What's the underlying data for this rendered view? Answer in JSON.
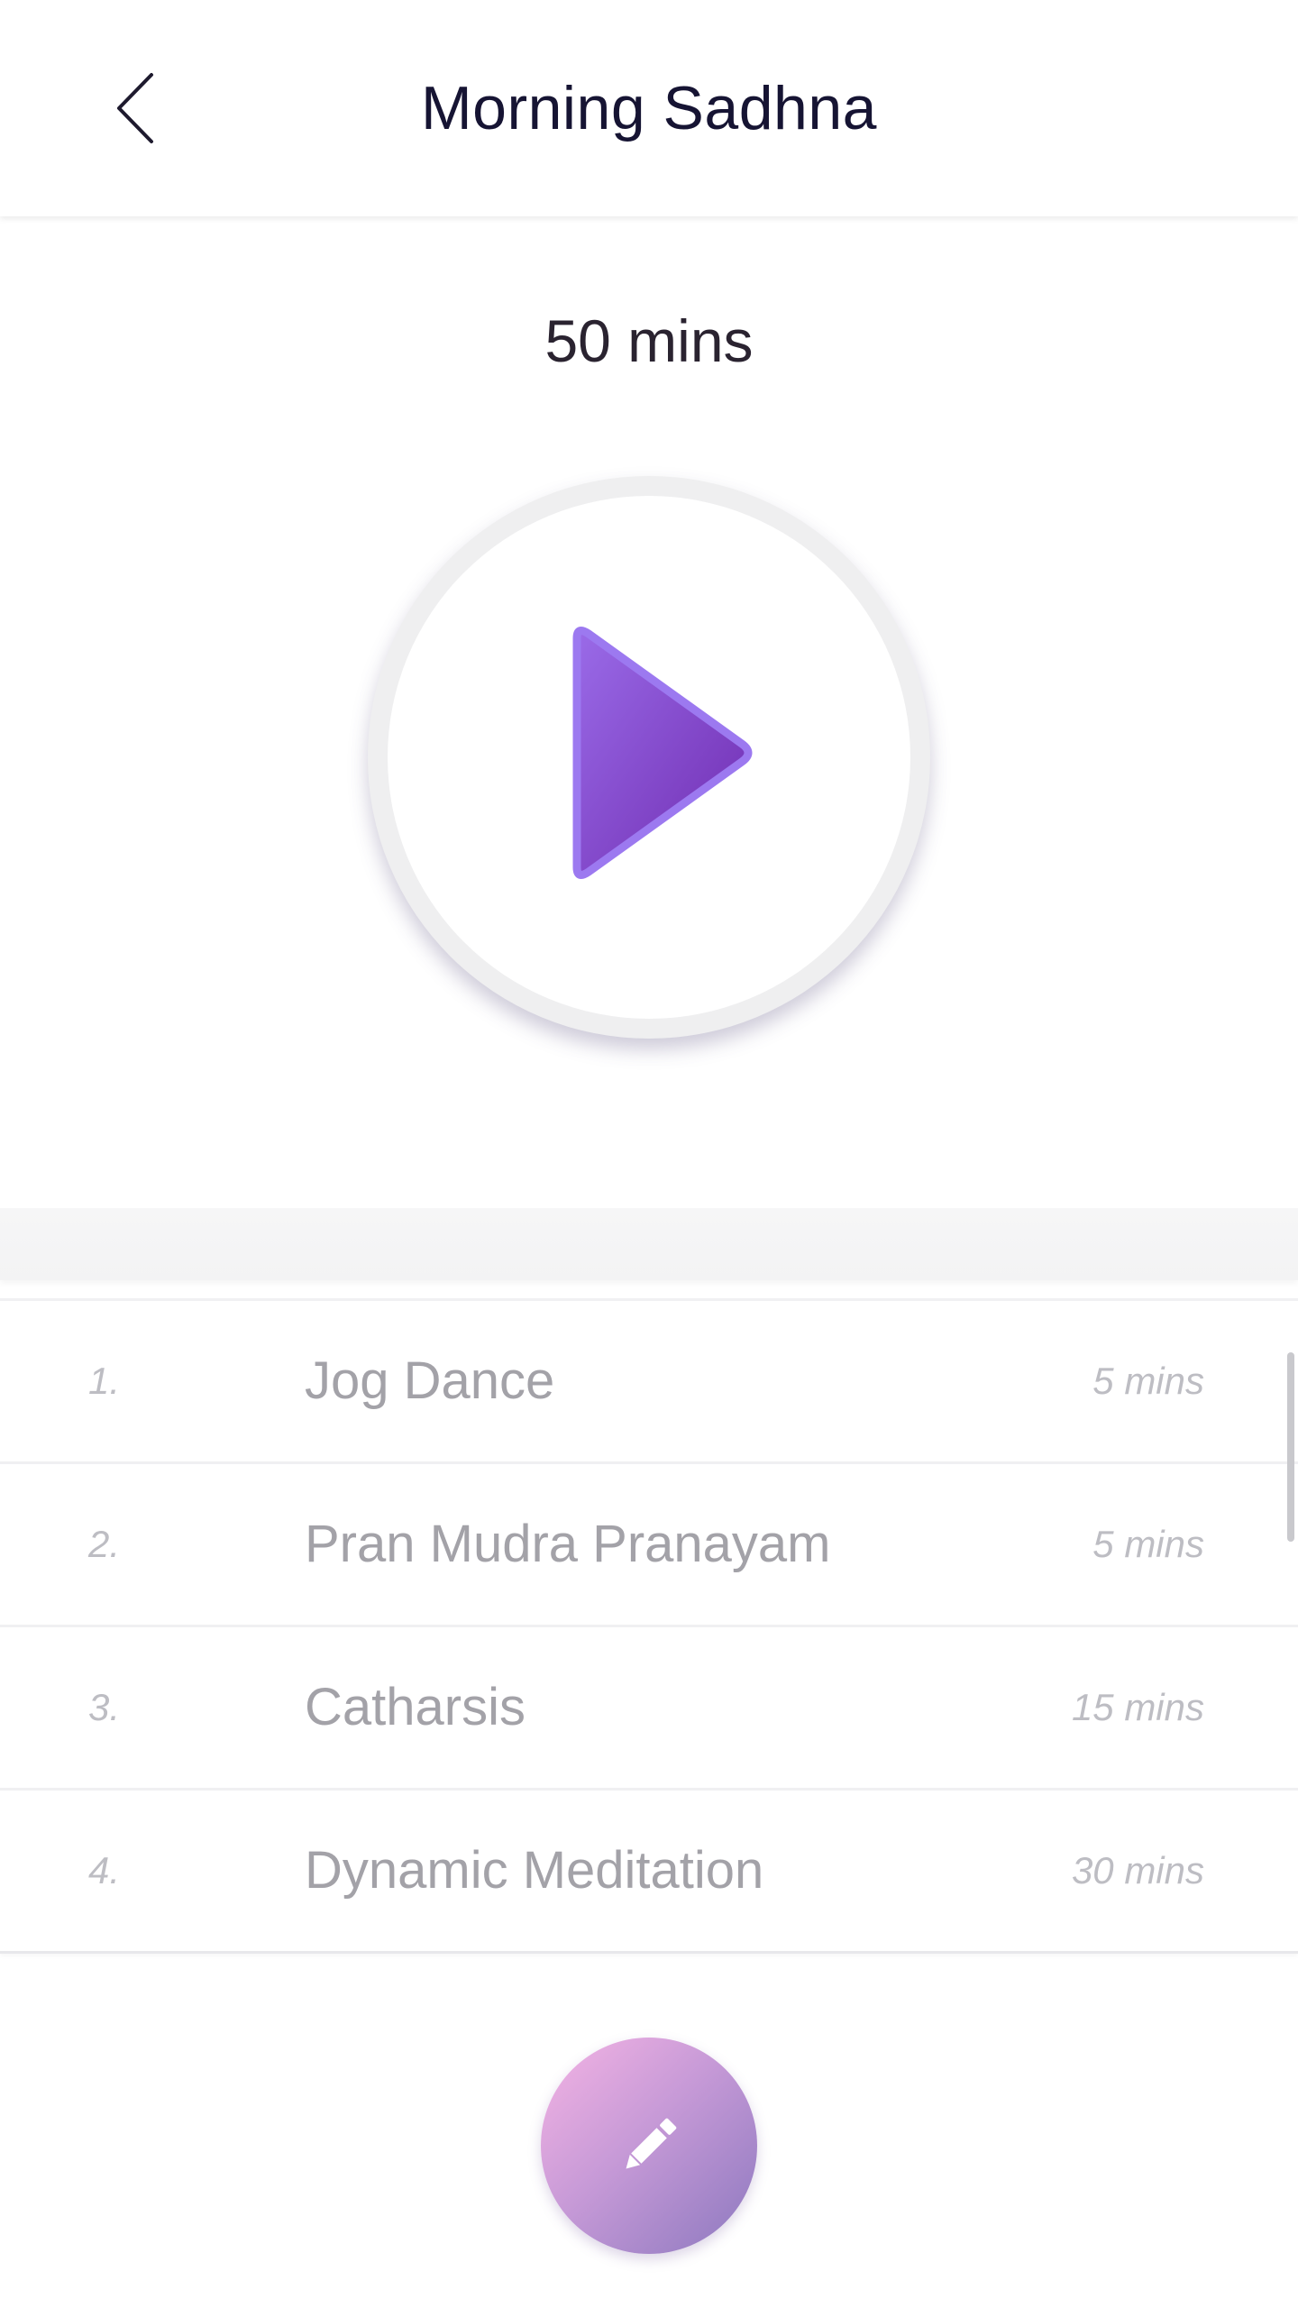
{
  "header": {
    "title": "Morning Sadhna",
    "back_icon": "chevron-left-icon"
  },
  "summary": {
    "duration": "50 mins"
  },
  "player": {
    "play_icon": "play-icon",
    "accent_colors": [
      "#9a6be8",
      "#6f2bb0",
      "#9c79f0"
    ]
  },
  "list": {
    "items": [
      {
        "index": "1.",
        "title": "Jog Dance",
        "duration": "5 mins"
      },
      {
        "index": "2.",
        "title": "Pran Mudra Pranayam",
        "duration": "5 mins"
      },
      {
        "index": "3.",
        "title": "Catharsis",
        "duration": "15 mins"
      },
      {
        "index": "4.",
        "title": "Dynamic Meditation",
        "duration": "30 mins"
      }
    ]
  },
  "fab": {
    "icon": "pencil-icon",
    "gradient": [
      "#f5b4e4",
      "#8c78bf"
    ]
  }
}
